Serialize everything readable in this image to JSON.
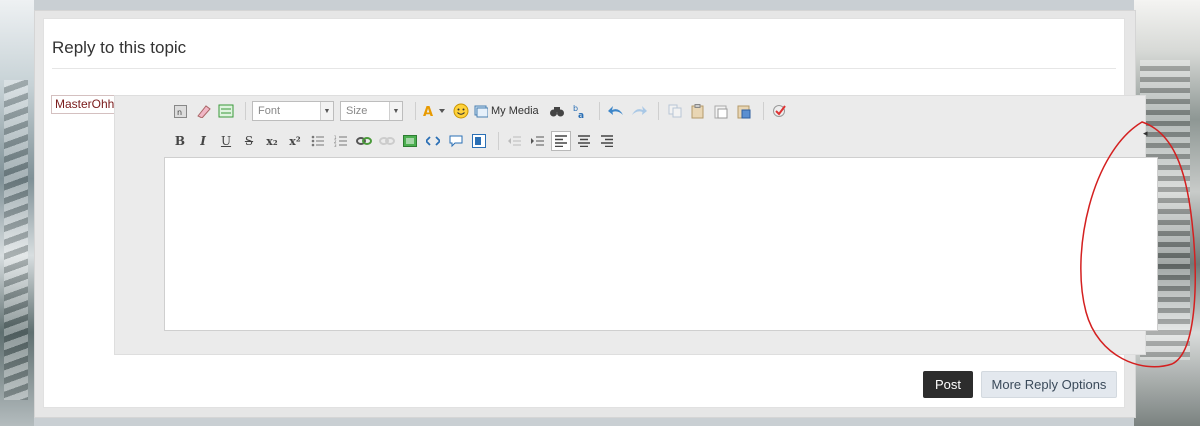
{
  "form": {
    "title": "Reply to this topic",
    "photo_label": "MasterOhh's Photo"
  },
  "toolbar": {
    "font_select": "Font",
    "size_select": "Size",
    "my_media_label": "My Media",
    "bold": "B",
    "italic": "I",
    "underline": "U",
    "strike": "S",
    "subscript": "x₂",
    "superscript": "x²"
  },
  "buttons": {
    "post": "Post",
    "more_reply_options": "More Reply Options"
  },
  "colors": {
    "post_button": "#2d2d2d",
    "more_button": "#e3e8ee",
    "annotation_circle": "#d42020"
  }
}
